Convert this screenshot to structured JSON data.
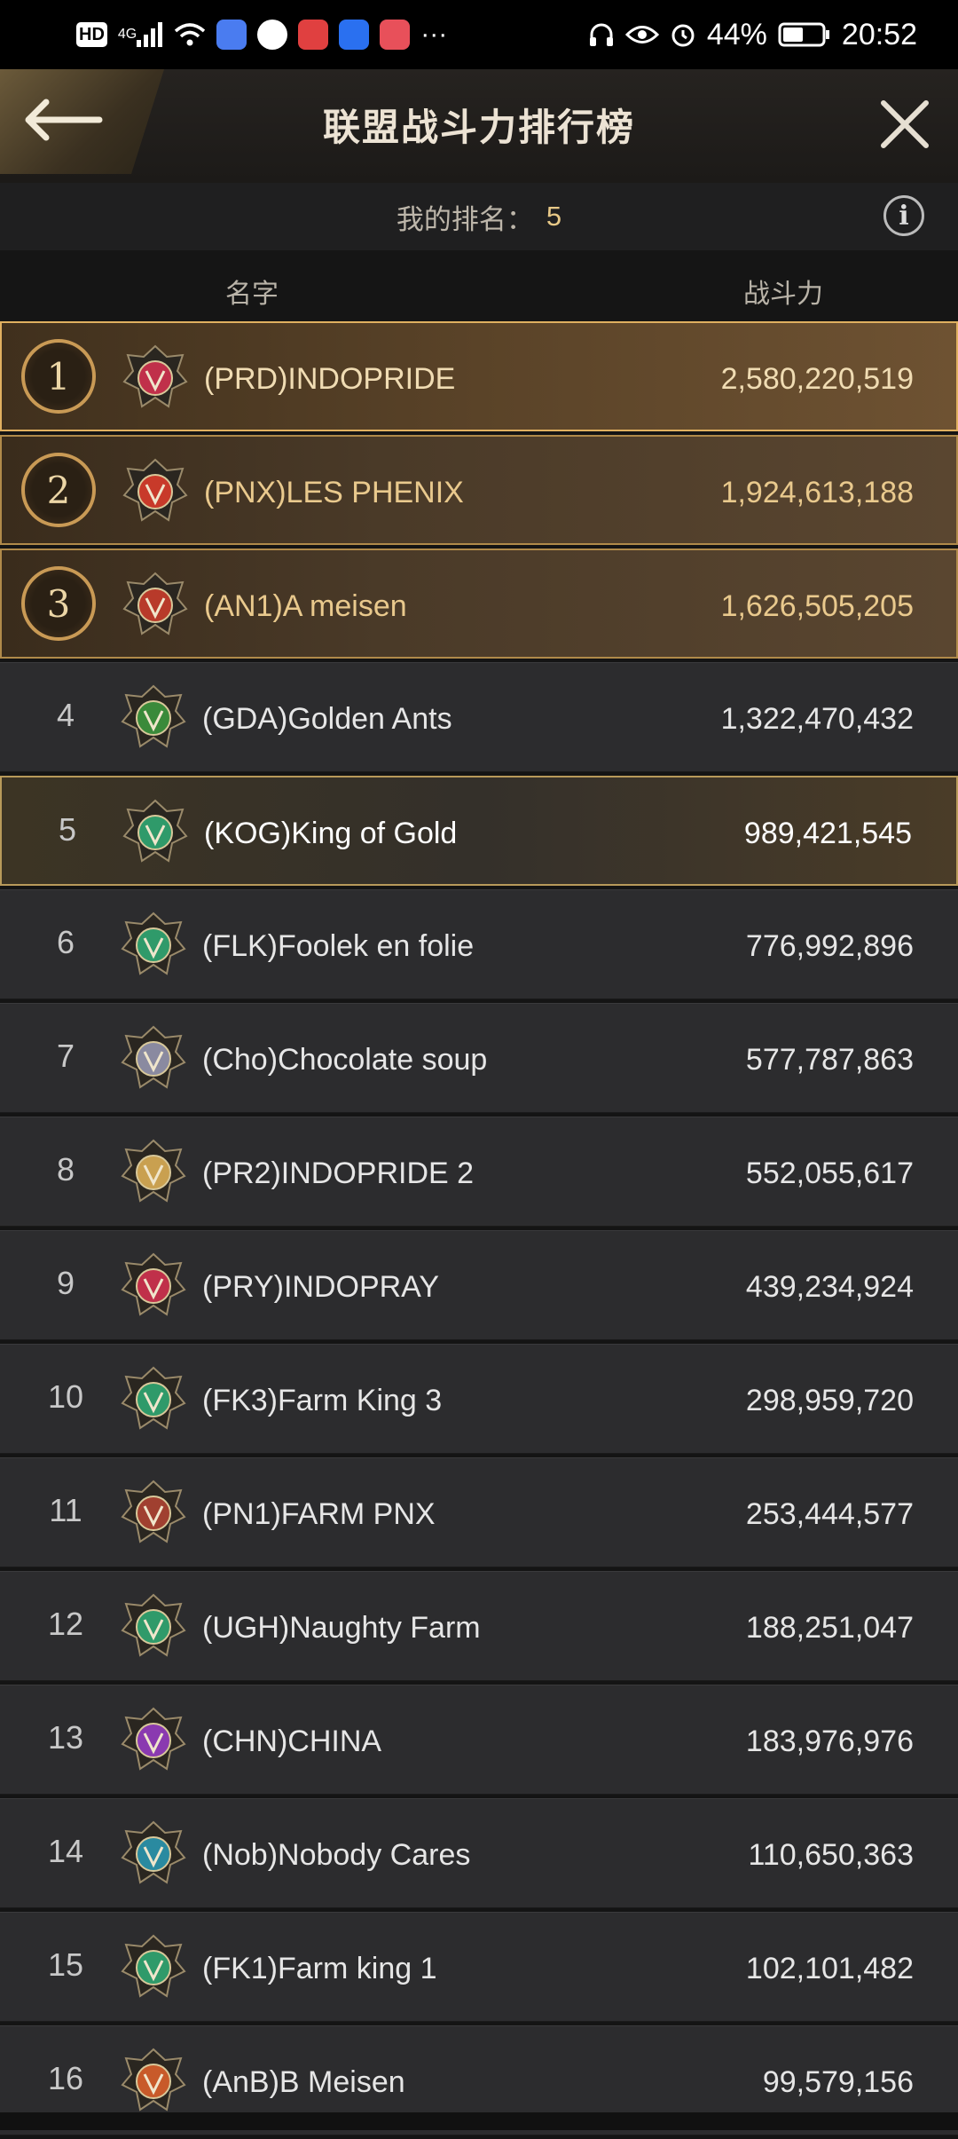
{
  "status_bar": {
    "left_label": "HD",
    "network": "4G",
    "more": "···",
    "battery": "44%",
    "time": "20:52"
  },
  "header": {
    "title": "联盟战斗力排行榜",
    "back_icon": "arrow-left-icon",
    "close_icon": "close-icon"
  },
  "my_rank": {
    "label": "我的排名：",
    "value": "5",
    "info_icon": "i"
  },
  "columns": {
    "name": "名字",
    "power": "战斗力"
  },
  "rows": [
    {
      "rank": "1",
      "name": "(PRD)INDOPRIDE",
      "power": "2,580,220,519",
      "emblem_color": "#c0304a"
    },
    {
      "rank": "2",
      "name": "(PNX)LES PHENIX",
      "power": "1,924,613,188",
      "emblem_color": "#c83a2a"
    },
    {
      "rank": "3",
      "name": "(AN1)A  meisen",
      "power": "1,626,505,205",
      "emblem_color": "#b83a2a"
    },
    {
      "rank": "4",
      "name": "(GDA)Golden Ants",
      "power": "1,322,470,432",
      "emblem_color": "#3a8a3a"
    },
    {
      "rank": "5",
      "name": "(KOG)King of Gold",
      "power": "989,421,545",
      "emblem_color": "#2f9a6a"
    },
    {
      "rank": "6",
      "name": "(FLK)Foolek en folie",
      "power": "776,992,896",
      "emblem_color": "#2f9a6a"
    },
    {
      "rank": "7",
      "name": "(Cho)Chocolate soup",
      "power": "577,787,863",
      "emblem_color": "#8a8aa0"
    },
    {
      "rank": "8",
      "name": "(PR2)INDOPRIDE 2",
      "power": "552,055,617",
      "emblem_color": "#c9a050"
    },
    {
      "rank": "9",
      "name": "(PRY)INDOPRAY",
      "power": "439,234,924",
      "emblem_color": "#c0304a"
    },
    {
      "rank": "10",
      "name": "(FK3)Farm King 3",
      "power": "298,959,720",
      "emblem_color": "#2f9a6a"
    },
    {
      "rank": "11",
      "name": "(PN1)FARM PNX",
      "power": "253,444,577",
      "emblem_color": "#a04030"
    },
    {
      "rank": "12",
      "name": "(UGH)Naughty Farm",
      "power": "188,251,047",
      "emblem_color": "#2f9a6a"
    },
    {
      "rank": "13",
      "name": "(CHN)CHINA",
      "power": "183,976,976",
      "emblem_color": "#8a3ab0"
    },
    {
      "rank": "14",
      "name": "(Nob)Nobody Cares",
      "power": "110,650,363",
      "emblem_color": "#2a8aa0"
    },
    {
      "rank": "15",
      "name": "(FK1)Farm king 1",
      "power": "102,101,482",
      "emblem_color": "#2f9a6a"
    },
    {
      "rank": "16",
      "name": "(AnB)B Meisen",
      "power": "99,579,156",
      "emblem_color": "#c85a2a"
    }
  ]
}
